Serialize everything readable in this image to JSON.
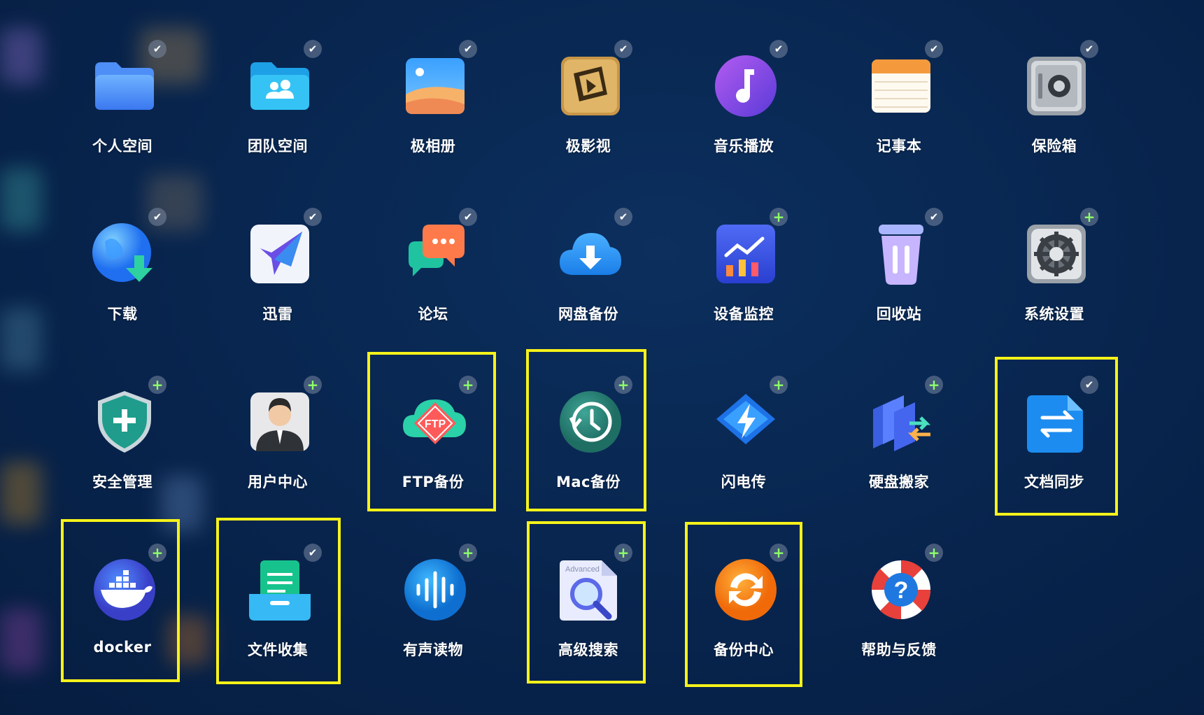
{
  "apps": [
    {
      "label": "个人空间",
      "icon": "folder-icon",
      "badge": "installed"
    },
    {
      "label": "团队空间",
      "icon": "team-folder-icon",
      "badge": "installed"
    },
    {
      "label": "极相册",
      "icon": "photo-album-icon",
      "badge": "installed"
    },
    {
      "label": "极影视",
      "icon": "video-icon",
      "badge": "installed"
    },
    {
      "label": "音乐播放",
      "icon": "music-note-icon",
      "badge": "installed"
    },
    {
      "label": "记事本",
      "icon": "notepad-icon",
      "badge": "installed"
    },
    {
      "label": "保险箱",
      "icon": "safe-icon",
      "badge": "installed"
    },
    {
      "label": "下载",
      "icon": "download-globe-icon",
      "badge": "installed"
    },
    {
      "label": "迅雷",
      "icon": "thunder-bird-icon",
      "badge": "installed"
    },
    {
      "label": "论坛",
      "icon": "forum-chat-icon",
      "badge": "installed"
    },
    {
      "label": "网盘备份",
      "icon": "cloud-download-icon",
      "badge": "installed"
    },
    {
      "label": "设备监控",
      "icon": "chart-monitor-icon",
      "badge": "add"
    },
    {
      "label": "回收站",
      "icon": "trash-icon",
      "badge": "installed"
    },
    {
      "label": "系统设置",
      "icon": "gear-icon",
      "badge": "add"
    },
    {
      "label": "安全管理",
      "icon": "shield-icon",
      "badge": "add"
    },
    {
      "label": "用户中心",
      "icon": "user-avatar-icon",
      "badge": "add"
    },
    {
      "label": "FTP备份",
      "icon": "ftp-cloud-icon",
      "badge": "add",
      "highlight": true
    },
    {
      "label": "Mac备份",
      "icon": "time-machine-icon",
      "badge": "add",
      "highlight": true
    },
    {
      "label": "闪电传",
      "icon": "lightning-icon",
      "badge": "add"
    },
    {
      "label": "硬盘搬家",
      "icon": "disk-move-icon",
      "badge": "add"
    },
    {
      "label": "文档同步",
      "icon": "doc-sync-icon",
      "badge": "installed",
      "highlight": true
    },
    {
      "label": "docker",
      "icon": "docker-whale-icon",
      "badge": "add",
      "highlight": true
    },
    {
      "label": "文件收集",
      "icon": "file-collect-icon",
      "badge": "installed",
      "highlight": true
    },
    {
      "label": "有声读物",
      "icon": "audio-wave-icon",
      "badge": "add"
    },
    {
      "label": "高级搜索",
      "icon": "advanced-search-icon",
      "badge": "add",
      "highlight": true,
      "icon_text": "Advanced"
    },
    {
      "label": "备份中心",
      "icon": "backup-sync-icon",
      "badge": "add",
      "highlight": true
    },
    {
      "label": "帮助与反馈",
      "icon": "help-lifebuoy-icon",
      "badge": "add"
    }
  ],
  "badges": {
    "installed": "✔",
    "add": "+"
  },
  "colors": {
    "highlight": "#f7f21a",
    "background": "#082650",
    "add_badge": "#8dff6a"
  }
}
